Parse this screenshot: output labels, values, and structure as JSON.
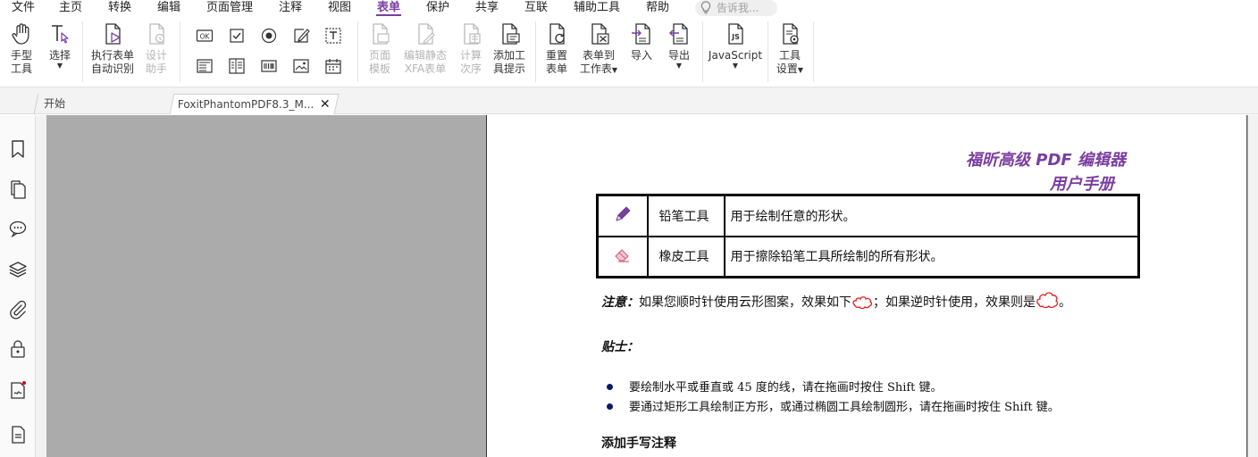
{
  "menu": {
    "items": [
      "文件",
      "主页",
      "转换",
      "编辑",
      "页面管理",
      "注释",
      "视图",
      "表单",
      "保护",
      "共享",
      "互联",
      "辅助工具",
      "帮助"
    ],
    "active": "表单",
    "search_placeholder": "告诉我..."
  },
  "ribbon": {
    "hand_tool": [
      "手型",
      "工具"
    ],
    "select": "选择",
    "run_form_recognition": [
      "执行表单",
      "自动识别"
    ],
    "design_assistant": [
      "设计",
      "助手"
    ],
    "page_template": [
      "页面",
      "模板"
    ],
    "edit_static_xfa": [
      "编辑静态",
      "XFA表单"
    ],
    "calc_order": [
      "计算",
      "次序"
    ],
    "add_tooltip": [
      "添加工",
      "具提示"
    ],
    "reset_form": [
      "重置",
      "表单"
    ],
    "form_to_sheet": [
      "表单到",
      "工作表"
    ],
    "import": "导入",
    "export": "导出",
    "javascript": "JavaScript",
    "tool_settings": [
      "工具",
      "设置"
    ]
  },
  "tabs": {
    "start": "开始",
    "document": "FoxitPhantomPDF8.3_M...",
    "close_glyph": "✕"
  },
  "doc": {
    "header_line1": "福昕高级 PDF 编辑器",
    "header_line2": "用户手册",
    "table": [
      {
        "name": "铅笔工具",
        "desc": "用于绘制任意的形状。",
        "icon": "pencil-icon"
      },
      {
        "name": "橡皮工具",
        "desc": "用于擦除铅笔工具所绘制的所有形状。",
        "icon": "eraser-icon"
      }
    ],
    "note_label": "注意：",
    "note_text_a": "如果您顺时针使用云形图案，效果如下",
    "note_text_b": "；如果逆时针使用，效果则是",
    "note_text_c": "。",
    "tips_label": "贴士：",
    "bullets": [
      "要绘制水平或垂直或  45  度的线，请在拖画时按住  Shift  键。",
      "要通过矩形工具绘制正方形，或通过椭圆工具绘制圆形，请在拖画时按住 Shift  键。"
    ],
    "section_title": "添加手写注释"
  },
  "colors": {
    "accent": "#7a3ea0",
    "canvas": "#ababab"
  }
}
